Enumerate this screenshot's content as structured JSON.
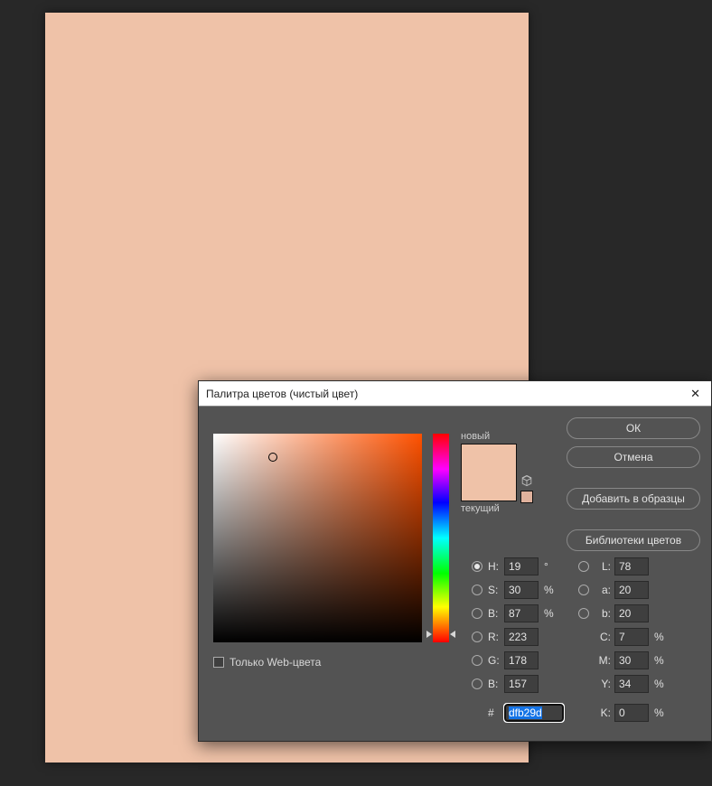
{
  "canvas": {
    "fill": "#efc2a8"
  },
  "dialog": {
    "title": "Палитра цветов (чистый цвет)",
    "swatch": {
      "new_label": "новый",
      "current_label": "текущий"
    },
    "buttons": {
      "ok": "ОК",
      "cancel": "Отмена",
      "add_to_swatches": "Добавить в образцы",
      "color_libraries": "Библиотеки цветов"
    },
    "hsb": {
      "h_label": "H:",
      "s_label": "S:",
      "b_label": "B:",
      "h": "19",
      "s": "30",
      "b": "87",
      "h_unit": "°",
      "s_unit": "%",
      "b_unit": "%"
    },
    "rgb": {
      "r_label": "R:",
      "g_label": "G:",
      "b_label": "B:",
      "r": "223",
      "g": "178",
      "b": "157"
    },
    "lab": {
      "l_label": "L:",
      "a_label": "a:",
      "b_label": "b:",
      "l": "78",
      "a": "20",
      "b": "20"
    },
    "cmyk": {
      "c_label": "C:",
      "m_label": "M:",
      "y_label": "Y:",
      "k_label": "K:",
      "c": "7",
      "m": "30",
      "y": "34",
      "k": "0",
      "unit": "%"
    },
    "hex": {
      "hash": "#",
      "value": "dfb29d"
    },
    "web_only": "Только Web-цвета",
    "selected_radio": "H"
  },
  "chart_data": null
}
